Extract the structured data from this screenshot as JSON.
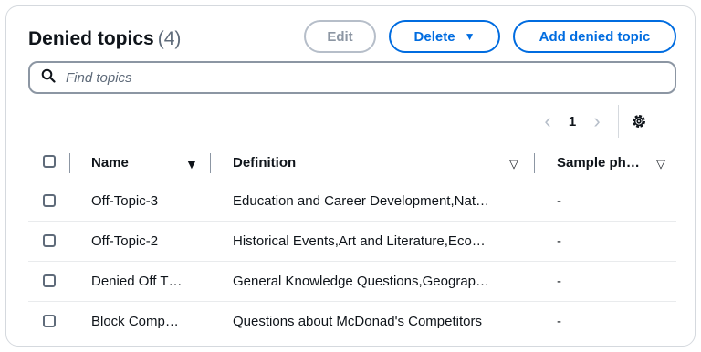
{
  "header": {
    "title": "Denied topics",
    "count": "(4)",
    "edit_label": "Edit",
    "delete_label": "Delete",
    "add_label": "Add denied topic"
  },
  "search": {
    "placeholder": "Find topics"
  },
  "pagination": {
    "current_page": "1"
  },
  "table": {
    "columns": [
      "Name",
      "Definition",
      "Sample ph…"
    ],
    "rows": [
      {
        "name": "Off-Topic-3",
        "definition": "Education and Career Development,Nat…",
        "sample": "-"
      },
      {
        "name": "Off-Topic-2",
        "definition": "Historical Events,Art and Literature,Eco…",
        "sample": "-"
      },
      {
        "name": "Denied Off T…",
        "definition": "General Knowledge Questions,Geograp…",
        "sample": "-"
      },
      {
        "name": "Block Comp…",
        "definition": "Questions about McDonad's Competitors",
        "sample": "-"
      }
    ]
  },
  "colors": {
    "accent": "#006ce0",
    "disabled": "#8c96a3",
    "text": "#0f141a",
    "border": "#d5d9de"
  },
  "icons": {
    "search": "search-icon",
    "caret_down": "caret-down-icon",
    "chevron_left": "chevron-left-icon",
    "chevron_right": "chevron-right-icon",
    "settings": "gear-icon",
    "sort_active": "sort-desc-filled-icon",
    "sort_inactive": "sort-outline-icon"
  }
}
